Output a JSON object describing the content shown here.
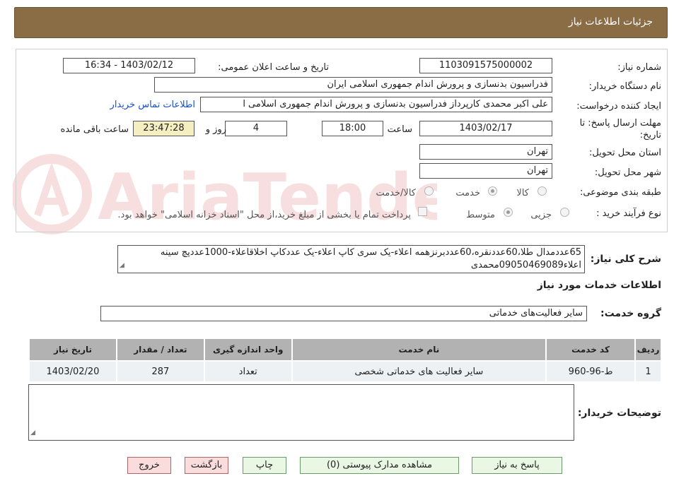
{
  "header": {
    "title": "جزئیات اطلاعات نیاز"
  },
  "form": {
    "need_number_label": "شماره نیاز:",
    "need_number": "1103091575000002",
    "announce_label": "تاریخ و ساعت اعلان عمومی:",
    "announce_value": "1403/02/12 - 16:34",
    "buyer_label": "نام دستگاه خریدار:",
    "buyer_value": "فدراسیون بدنسازی و پرورش اندام جمهوری اسلامی ایران",
    "creator_label": "ایجاد کننده درخواست:",
    "creator_value": "علی اکبر محمدی کارپرداز فدراسیون بدنسازی و پرورش اندام جمهوری اسلامی ا",
    "contact_link": "اطلاعات تماس خریدار",
    "deadline_label_1": "مهلت ارسال پاسخ: تا",
    "deadline_label_2": "تاریخ:",
    "deadline_date": "1403/02/17",
    "time_label": "ساعت",
    "deadline_time": "18:00",
    "days_value": "4",
    "days_label": "روز و",
    "remaining_time": "23:47:28",
    "remaining_label": "ساعت باقی مانده",
    "province_label": "استان محل تحویل:",
    "province_value": "تهران",
    "city_label": "شهر محل تحویل:",
    "city_value": "تهران",
    "category_label": "طبقه بندی موضوعی:",
    "category_options": [
      "کالا",
      "خدمت",
      "کالا/خدمت"
    ],
    "category_selected": "خدمت",
    "process_label": "نوع فرآیند خرید :",
    "process_options": [
      "جزیی",
      "متوسط"
    ],
    "process_selected": "متوسط",
    "payment_note": "پرداخت تمام یا بخشی از مبلغ خرید،از محل \"اسناد خزانه اسلامی\" خواهد بود."
  },
  "description": {
    "label": "شرح کلی نیاز:",
    "text": "65عددمدال طلا،60عددنقره،60عددبرنزهمه اعلاء-یک سری کاپ اعلاء-یک عددکاپ اخلاقاعلاء-1000عددپچ سینه اعلاء09050469089محمدی"
  },
  "services": {
    "section_title": "اطلاعات خدمات مورد نیاز",
    "group_label": "گروه خدمت:",
    "group_value": "سایر فعالیت‌های خدماتی",
    "columns": [
      "ردیف",
      "کد خدمت",
      "نام خدمت",
      "واحد اندازه گیری",
      "تعداد / مقدار",
      "تاریخ نیاز"
    ],
    "rows": [
      {
        "row": "1",
        "code": "ط-96-960",
        "name": "سایر فعالیت های خدماتی شخصی",
        "unit": "تعداد",
        "qty": "287",
        "date": "1403/02/20"
      }
    ]
  },
  "buyer_notes": {
    "label": "توضیحات خریدار:",
    "value": ""
  },
  "buttons": {
    "reply": "پاسخ به نیاز",
    "attachments": "مشاهده مدارک پیوستی (0)",
    "print": "چاپ",
    "back": "بازگشت",
    "exit": "خروج"
  },
  "watermark": {
    "brand": "AriaTender.neT"
  },
  "colors": {
    "header_bg": "#8b6d45",
    "table_header": "#b2b2b2",
    "highlight": "#f5eec0",
    "button_green": "#e9f7e4",
    "button_red": "#fbdcdc"
  }
}
